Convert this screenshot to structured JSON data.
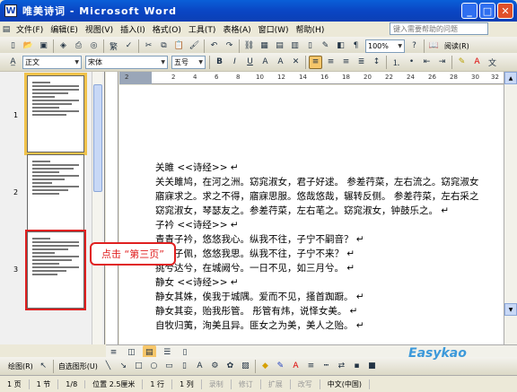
{
  "window": {
    "title": "唯美诗词 - Microsoft Word",
    "icon_letter": "W"
  },
  "menu": [
    "文件(F)",
    "编辑(E)",
    "视图(V)",
    "插入(I)",
    "格式(O)",
    "工具(T)",
    "表格(A)",
    "窗口(W)",
    "帮助(H)"
  ],
  "help_placeholder": "键入需要帮助的问题",
  "toolbar": {
    "zoom": "100%",
    "read_label": "阅读(R)"
  },
  "format": {
    "style": "正文",
    "font": "宋体",
    "size": "五号"
  },
  "thumbnails": [
    {
      "page": "1"
    },
    {
      "page": "2"
    },
    {
      "page": "3"
    }
  ],
  "ruler_ticks": [
    "2",
    "2",
    "4",
    "6",
    "8",
    "10",
    "12",
    "14",
    "16",
    "18",
    "20",
    "22",
    "24",
    "26",
    "28",
    "30",
    "32"
  ],
  "document_lines": [
    "关雎 <<诗经>> ↵",
    "关关雎鸠，在河之洲。窈窕淑女，君子好逑。 参差荇菜，左右流之。窈窕淑女",
    "寤寐求之。求之不得，寤寐思服。悠哉悠哉，辗转反侧。 参差荇菜，左右采之",
    "窈窕淑女，琴瑟友之。参差荇菜，左右芼之。窈窕淑女，钟鼓乐之。 ↵",
    "子衿 <<诗经>> ↵",
    "青青子衿，悠悠我心。纵我不往，子宁不嗣音？ ↵",
    "青青子佩，悠悠我思。纵我不往，子宁不来？ ↵",
    "挑兮达兮，在城阙兮。一日不见，如三月兮。 ↵",
    "静女 <<诗经>> ↵",
    "静女其姝，俟我于城隅。爱而不见，搔首踟蹰。 ↵",
    "静女其娈，贻我彤管。 彤管有炜，说怿女美。 ↵",
    "自牧归荑，洵美且异。匪女之为美，美人之贻。 ↵"
  ],
  "callout": "点击 “第三页”",
  "drawbar": {
    "draw_label": "绘图(R)",
    "autoshape_label": "自选图形(U)"
  },
  "status": {
    "page": "1 页",
    "section": "1 节",
    "pages": "1/8",
    "position": "位置 2.5厘米",
    "line": "1 行",
    "column": "1 列",
    "rec": "录制",
    "trk": "修订",
    "ext": "扩展",
    "ovr": "改写",
    "lang": "中文(中国)"
  },
  "watermark": "Easykao"
}
